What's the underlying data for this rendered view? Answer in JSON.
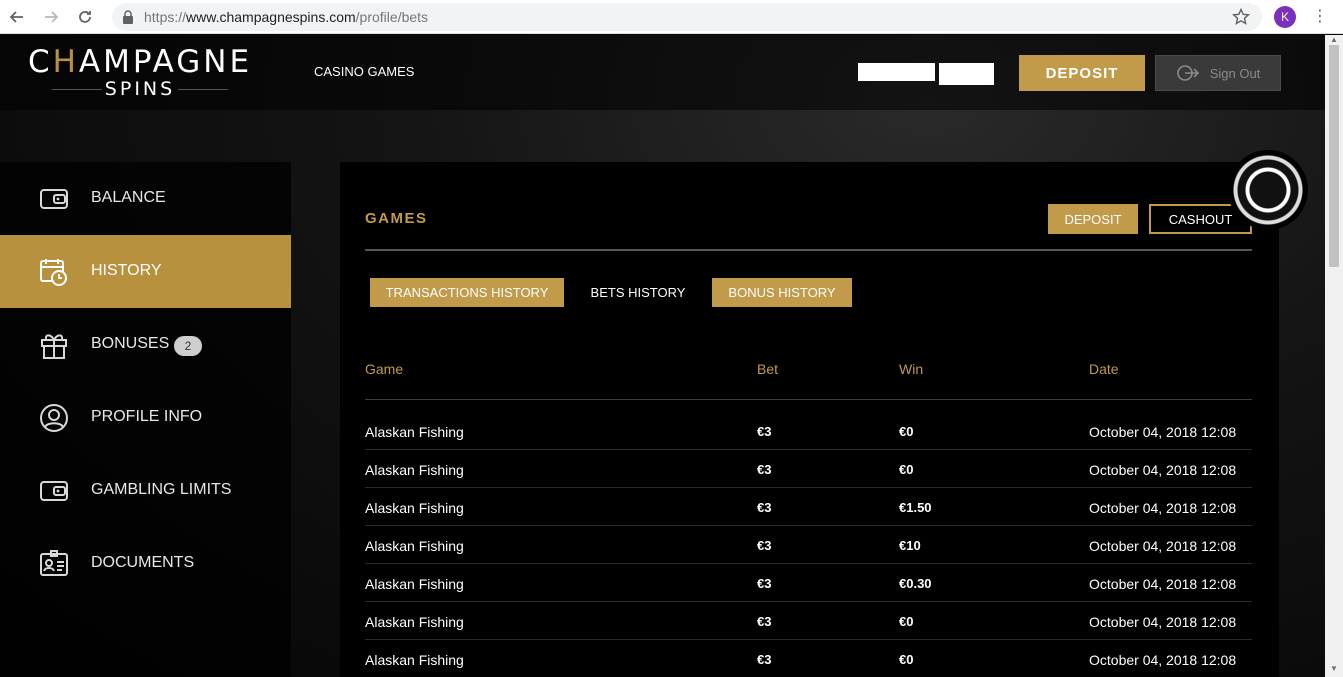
{
  "browser": {
    "url_scheme": "https://",
    "url_host": "www.champagnespins.com",
    "url_path": "/profile/bets",
    "profile_initial": "K"
  },
  "header": {
    "logo_line1_a": "C",
    "logo_line1_h": "H",
    "logo_line1_b": "AMPAGNE",
    "logo_line2": "SPINS",
    "nav_casino_games": "CASINO GAMES",
    "deposit_label": "DEPOSIT",
    "signout_label": "Sign Out"
  },
  "sidebar": {
    "items": [
      {
        "label": "BALANCE",
        "icon": "wallet-icon"
      },
      {
        "label": "HISTORY",
        "icon": "calendar-clock-icon"
      },
      {
        "label": "BONUSES",
        "icon": "gift-icon",
        "badge": "2"
      },
      {
        "label": "PROFILE INFO",
        "icon": "user-icon"
      },
      {
        "label": "GAMBLING LIMITS",
        "icon": "wallet-icon"
      },
      {
        "label": "DOCUMENTS",
        "icon": "id-card-icon"
      }
    ],
    "active_index": 1
  },
  "panel": {
    "title": "GAMES",
    "deposit_label": "DEPOSIT",
    "cashout_label": "CASHOUT",
    "tabs": [
      {
        "label": "TRANSACTIONS HISTORY"
      },
      {
        "label": "BETS HISTORY"
      },
      {
        "label": "BONUS HISTORY"
      }
    ],
    "active_tab": 1,
    "columns": [
      "Game",
      "Bet",
      "Win",
      "Date"
    ],
    "rows": [
      {
        "game": "Alaskan Fishing",
        "bet": "€3",
        "win": "€0",
        "date": "October 04, 2018 12:08"
      },
      {
        "game": "Alaskan Fishing",
        "bet": "€3",
        "win": "€0",
        "date": "October 04, 2018 12:08"
      },
      {
        "game": "Alaskan Fishing",
        "bet": "€3",
        "win": "€1.50",
        "date": "October 04, 2018 12:08"
      },
      {
        "game": "Alaskan Fishing",
        "bet": "€3",
        "win": "€10",
        "date": "October 04, 2018 12:08"
      },
      {
        "game": "Alaskan Fishing",
        "bet": "€3",
        "win": "€0.30",
        "date": "October 04, 2018 12:08"
      },
      {
        "game": "Alaskan Fishing",
        "bet": "€3",
        "win": "€0",
        "date": "October 04, 2018 12:08"
      },
      {
        "game": "Alaskan Fishing",
        "bet": "€3",
        "win": "€0",
        "date": "October 04, 2018 12:08"
      }
    ]
  },
  "colors": {
    "gold": "#c19a4a",
    "sidebar_active": "#b8913f"
  }
}
